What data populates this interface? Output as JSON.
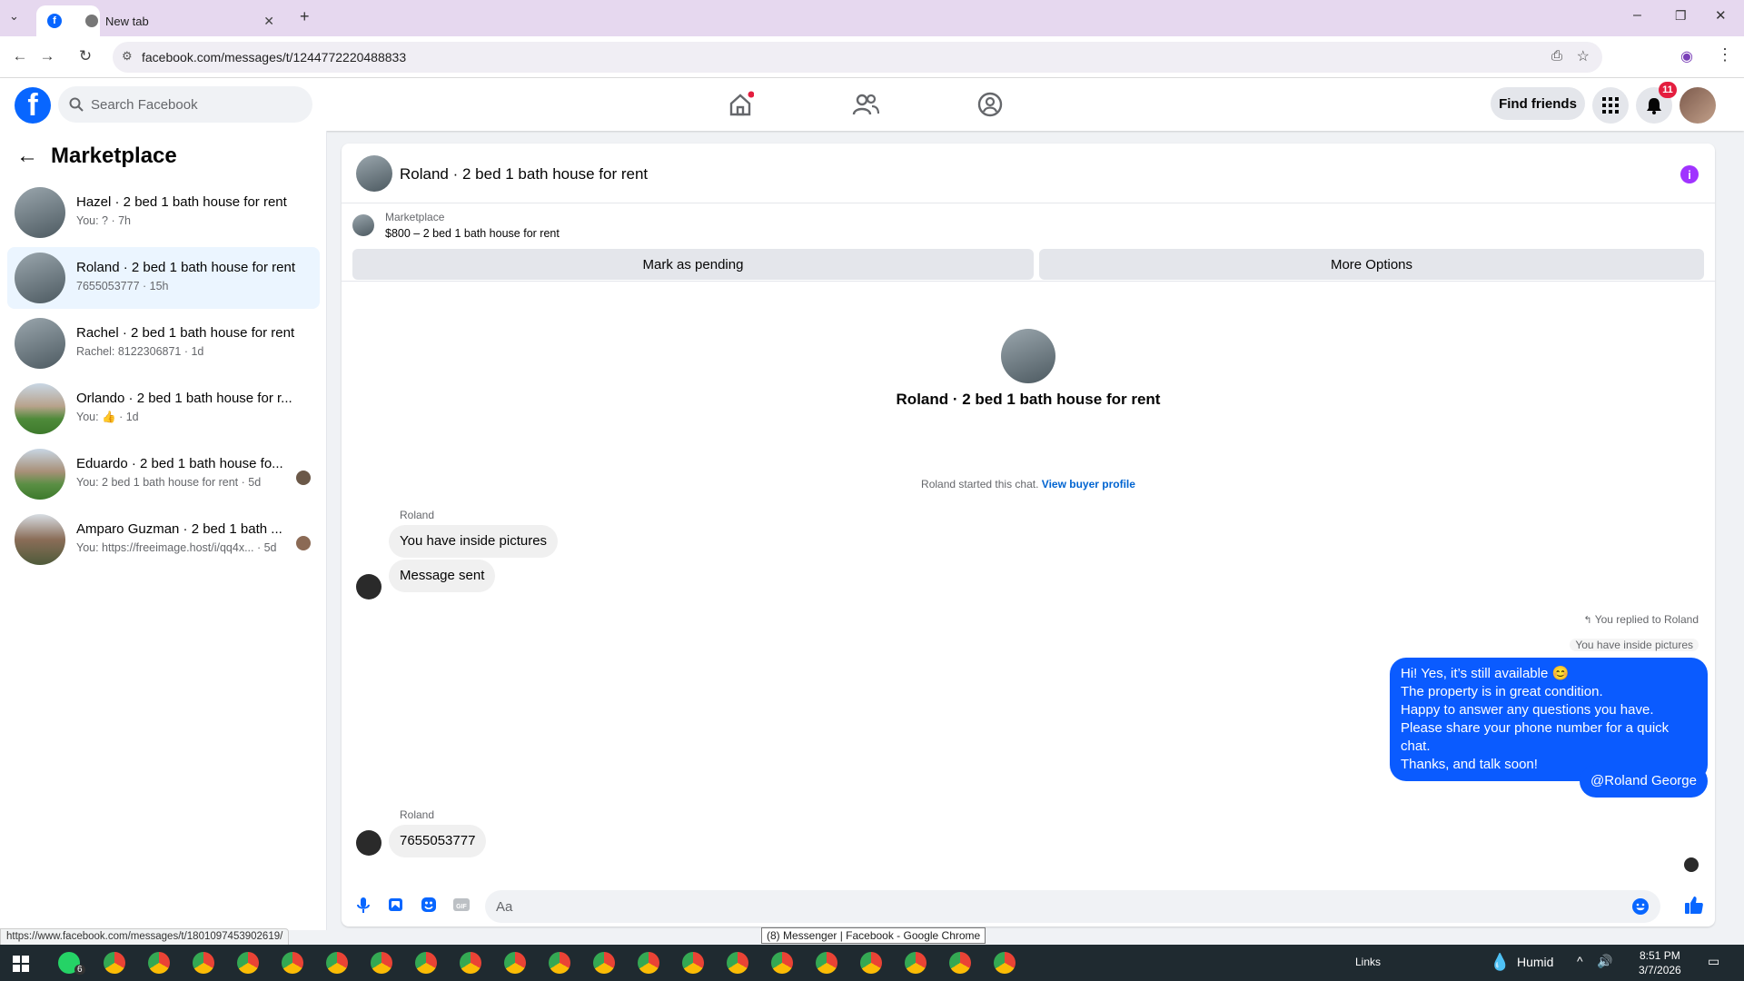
{
  "browser": {
    "tabs": [
      {
        "label": ""
      },
      {
        "label": "New tab"
      }
    ],
    "url": "facebook.com/messages/t/1244772220488833",
    "status_url": "https://www.facebook.com/messages/t/1801097453902619/",
    "window_tooltip": "(8) Messenger | Facebook - Google Chrome"
  },
  "header": {
    "search_placeholder": "Search Facebook",
    "find_friends": "Find friends",
    "notification_count": "11"
  },
  "sidebar": {
    "title": "Marketplace",
    "conversations": [
      {
        "title": "Hazel · 2 bed 1 bath house for rent",
        "subtitle": "You: ? · 7h"
      },
      {
        "title": "Roland · 2 bed 1 bath house for rent",
        "subtitle": "7655053777 · 15h"
      },
      {
        "title": "Rachel · 2 bed 1 bath house for rent",
        "subtitle": "Rachel: 8122306871 · 1d"
      },
      {
        "title": "Orlando · 2 bed 1 bath house for r...",
        "subtitle": "You: 👍 · 1d"
      },
      {
        "title": "Eduardo · 2 bed 1 bath house fo...",
        "subtitle": "You: 2 bed 1 bath house for rent · 5d"
      },
      {
        "title": "Amparo Guzman · 2 bed 1 bath ...",
        "subtitle": "You: https://freeimage.host/i/qq4x... · 5d"
      }
    ]
  },
  "chat": {
    "name": "Roland · 2 bed 1 bath house for rent",
    "listing_source": "Marketplace",
    "listing_price": "$800 – 2 bed 1 bath house for rent",
    "mark_pending": "Mark as pending",
    "more_options": "More Options",
    "center_name": "Roland · 2 bed 1 bath house for rent",
    "started_text": "Roland started this chat.",
    "view_profile": "View buyer profile",
    "messages": {
      "sender1": "Roland",
      "msg1": "You have inside pictures",
      "msg2": "Message sent",
      "replied_label": "You replied to Roland",
      "quoted": "You have inside pictures",
      "reply_lines": [
        "Hi! Yes, it’s still available 😊",
        "The property is in great condition.",
        "Happy to answer any questions you have.",
        "Please share your phone number for a quick chat.",
        "Thanks, and talk soon!"
      ],
      "mention": "@Roland George",
      "sender2": "Roland",
      "msg3": "7655053777"
    },
    "composer_placeholder": "Aa"
  },
  "taskbar": {
    "whatsapp_badge": "6",
    "links": "Links",
    "weather": "Humid",
    "time": "8:51 PM",
    "date": "3/7/2026"
  },
  "colors": {
    "fb_blue": "#0866ff",
    "bubble_out": "#0a5bff",
    "info_purple": "#a033ff",
    "badge_red": "#e41e3f"
  }
}
